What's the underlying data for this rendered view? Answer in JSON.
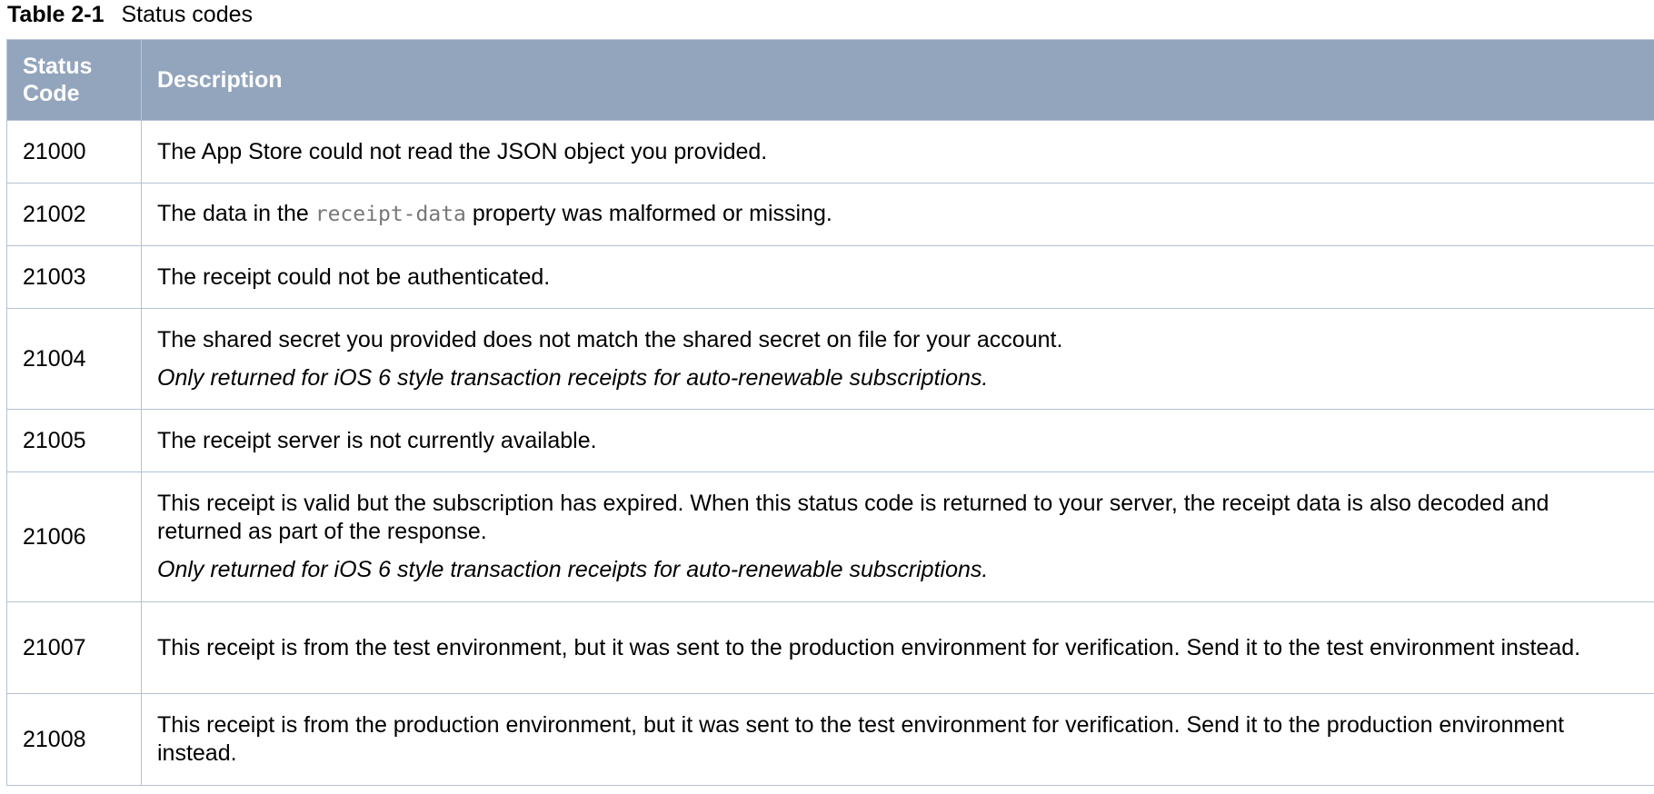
{
  "caption": {
    "label": "Table 2-1",
    "title": "Status codes"
  },
  "header": {
    "code": "Status Code",
    "description": "Description"
  },
  "rows": [
    {
      "code": "21000",
      "desc": "The App Store could not read the JSON object you provided."
    },
    {
      "code": "21002",
      "desc_before": "The data in the ",
      "desc_code": "receipt-data",
      "desc_after": " property was malformed or missing."
    },
    {
      "code": "21003",
      "desc": "The receipt could not be authenticated."
    },
    {
      "code": "21004",
      "desc": "The shared secret you provided does not match the shared secret on file for your account.",
      "note": "Only returned for iOS 6 style transaction receipts for auto-renewable subscriptions."
    },
    {
      "code": "21005",
      "desc": "The receipt server is not currently available."
    },
    {
      "code": "21006",
      "desc": "This receipt is valid but the subscription has expired. When this status code is returned to your server, the receipt data is also decoded and returned as part of the response.",
      "note": "Only returned for iOS 6 style transaction receipts for auto-renewable subscriptions."
    },
    {
      "code": "21007",
      "desc": "This receipt is from the test environment, but it was sent to the production environment for verification. Send it to the test environment instead."
    },
    {
      "code": "21008",
      "desc": "This receipt is from the production environment, but it was sent to the test environment for verification. Send it to the production environment instead."
    }
  ],
  "colors": {
    "header_background": "#93a5bd",
    "border": "#b3c2d3",
    "code_text": "#777777"
  }
}
